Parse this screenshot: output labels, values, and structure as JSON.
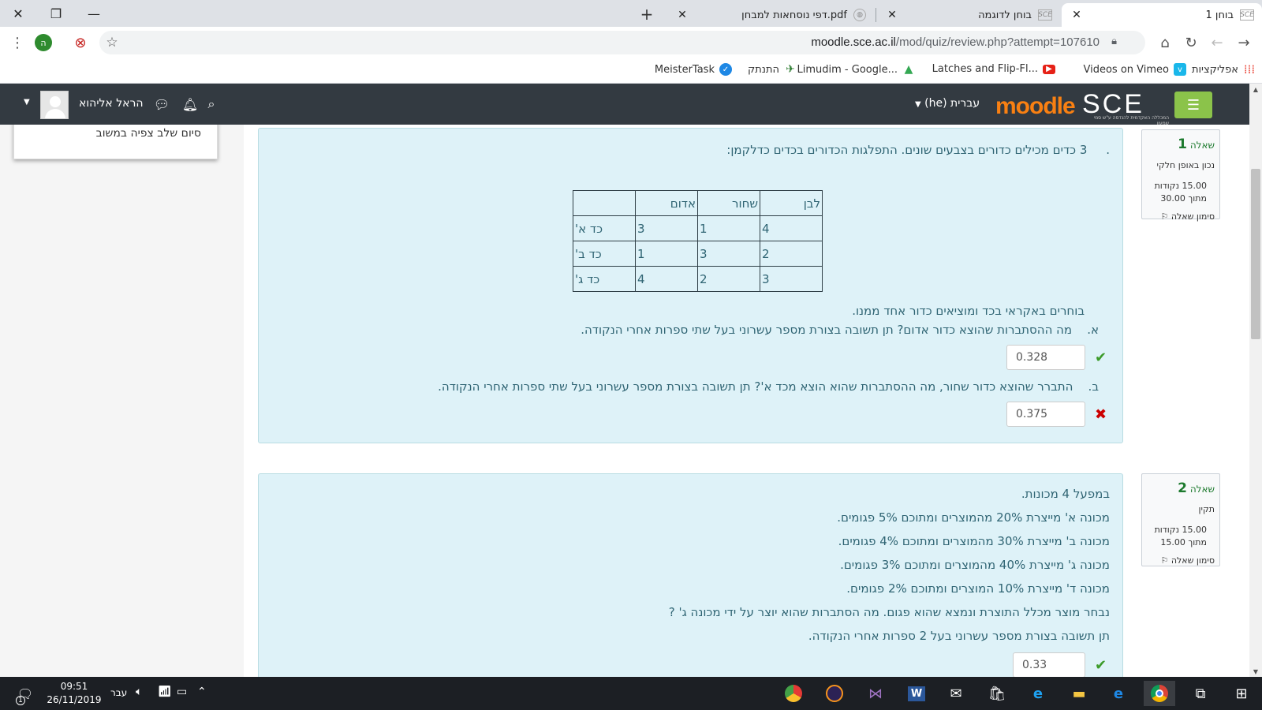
{
  "browser": {
    "tabs": [
      {
        "title": "בוחן 1",
        "favicon": "SCE"
      },
      {
        "title": "בוחן לדוגמה",
        "favicon": "SCE"
      },
      {
        "title": "דפי נוסחאות למבחן.pdf",
        "favicon": "globe"
      }
    ],
    "url_host": "moodle.sce.ac.il",
    "url_path": "/mod/quiz/review.php?attempt=107610",
    "profile_initial": "ה",
    "bookmarks": [
      {
        "label": "אפליקציות",
        "icon": "apps-grid"
      },
      {
        "label": "Videos on Vimeo",
        "icon": "vimeo"
      },
      {
        "label": "Latches and Flip-Fl...",
        "icon": "youtube"
      },
      {
        "label": "Limudim - Google...",
        "icon": "google-drive"
      },
      {
        "label": "התנתק",
        "icon": "bird"
      },
      {
        "label": "MeisterTask",
        "icon": "meistertask"
      }
    ]
  },
  "navbar": {
    "logo_sce": "SCE",
    "logo_sub": "המכללה האקדמית להנדסה ע\"ש סמי שמעון",
    "logo_moodle": "moodle",
    "language": "עברית (he)",
    "user_name": "הראל אליהוא"
  },
  "block": {
    "text": "סיום שלב צפיה במשוב"
  },
  "questions": [
    {
      "label": "שאלה",
      "number": "1",
      "state": "נכון באופן חלקי",
      "grade_line1": "15.00 נקודות",
      "grade_line2": "מתוך 30.00",
      "flag": "סימון שאלה",
      "intro": "3 כדים מכילים כדורים בצבעים שונים. התפלגות הכדורים בכדים כדלקמן:",
      "intro_marker": ".",
      "table": {
        "headers": [
          "לבן",
          "שחור",
          "אדום",
          ""
        ],
        "rows": [
          [
            "4",
            "1",
            "3",
            "כד א'"
          ],
          [
            "2",
            "3",
            "1",
            "כד ב'"
          ],
          [
            "3",
            "2",
            "4",
            "כד ג'"
          ]
        ]
      },
      "line2": "בוחרים באקראי בכד ומוציאים כדור אחד ממנו.",
      "part_a_marker": "א.",
      "part_a": "מה ההסתברות שהוצא כדור אדום? תן תשובה בצורת מספר עשרוני בעל שתי ספרות אחרי הנקודה.",
      "answer_a": "0.328",
      "part_b_marker": "ב.",
      "part_b": "התברר שהוצא כדור שחור, מה ההסתברות שהוא הוצא מכד א'? תן תשובה בצורת מספר עשרוני בעל שתי ספרות אחרי הנקודה.",
      "answer_b": "0.375"
    },
    {
      "label": "שאלה",
      "number": "2",
      "state": "תקין",
      "grade_line1": "15.00 נקודות",
      "grade_line2": "מתוך 15.00",
      "flag": "סימון שאלה",
      "lines": [
        "במפעל 4 מכונות.",
        "מכונה א' מייצרת 20% מהמוצרים ומתוכם 5% פגומים.",
        "מכונה ב' מייצרת 30% מהמוצרים ומתוכם 4% פגומים.",
        "מכונה ג' מייצרת 40% מהמוצרים ומתוכם 3% פגומים.",
        "מכונה ד' מייצרת 10% המוצרים ומתוכם 2% פגומים.",
        "נבחר מוצר מכלל התוצרת ונמצא שהוא פגום. מה הסתברות שהוא יוצר על ידי מכונה ג' ?",
        "תן תשובה בצורת מספר עשרוני בעל 2 ספרות אחרי הנקודה."
      ],
      "answer": "0.33"
    }
  ],
  "taskbar": {
    "time": "09:51",
    "date": "26/11/2019",
    "language": "עבר",
    "notification_count": "1"
  },
  "colors": {
    "navbar": "#333a41",
    "accent_green": "#8bc34a",
    "moodle_orange": "#f98012",
    "question_bg": "#def2f8",
    "question_text": "#2f6473"
  }
}
